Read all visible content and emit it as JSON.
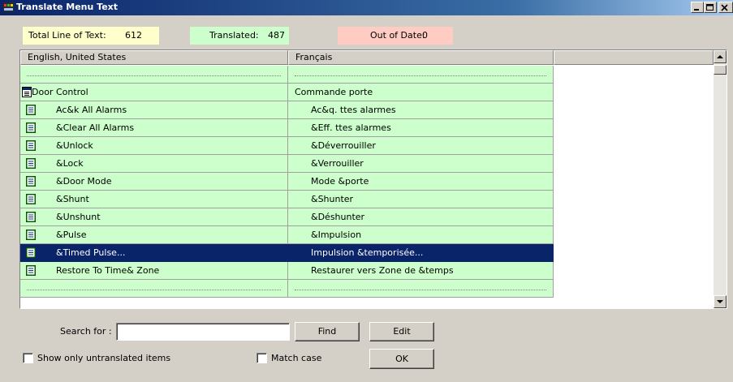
{
  "window": {
    "title": "Translate Menu Text"
  },
  "stats": {
    "total_label": "Total Line of Text:",
    "total_value": "612",
    "translated_label": "Translated:",
    "translated_value": "487",
    "outofdate_label": "Out of Date:",
    "outofdate_value": "0"
  },
  "grid": {
    "columns": [
      "English, United States",
      "Français",
      ""
    ],
    "rows": [
      {
        "en": "",
        "fr": "",
        "type": "blank"
      },
      {
        "en": "Door Control",
        "fr": "Commande porte",
        "type": "menu"
      },
      {
        "en": "Ac&k All Alarms",
        "fr": "Ac&q. ttes alarmes",
        "type": "item"
      },
      {
        "en": "&Clear All Alarms",
        "fr": "&Eff. ttes alarmes",
        "type": "item"
      },
      {
        "en": "&Unlock",
        "fr": "&Déverrouiller",
        "type": "item"
      },
      {
        "en": "&Lock",
        "fr": "&Verrouiller",
        "type": "item"
      },
      {
        "en": "&Door Mode",
        "fr": "Mode &porte",
        "type": "item"
      },
      {
        "en": "&Shunt",
        "fr": "&Shunter",
        "type": "item"
      },
      {
        "en": "&Unshunt",
        "fr": "&Déshunter",
        "type": "item"
      },
      {
        "en": "&Pulse",
        "fr": "&Impulsion",
        "type": "item"
      },
      {
        "en": "&Timed Pulse...",
        "fr": "Impulsion &temporisée...",
        "type": "item",
        "selected": true
      },
      {
        "en": "Restore To Time& Zone",
        "fr": "Restaurer vers Zone de &temps",
        "type": "item"
      },
      {
        "en": "",
        "fr": "",
        "type": "blank"
      }
    ]
  },
  "search": {
    "label": "Search for :",
    "value": ""
  },
  "buttons": {
    "find": "Find",
    "edit": "Edit",
    "ok": "OK"
  },
  "options": {
    "show_untranslated": {
      "label": "Show only untranslated items",
      "checked": false
    },
    "match_case": {
      "label": "Match case",
      "checked": false
    }
  },
  "colors": {
    "total_bg": "#ffffcc",
    "translated_bg": "#ccffcc",
    "outofdate_bg": "#ffccc4",
    "row_bg": "#ccffcc",
    "selection": "#0a246a"
  }
}
